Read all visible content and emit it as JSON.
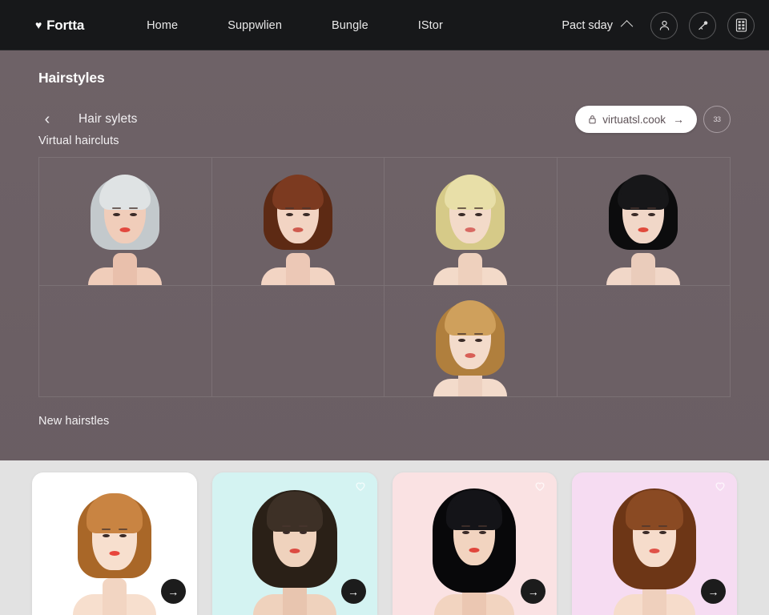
{
  "navbar": {
    "brand": "Fortta",
    "brand_icon": "heart-icon",
    "links": [
      {
        "label": "Home"
      },
      {
        "label": "Suppwlien"
      },
      {
        "label": "Bungle"
      },
      {
        "label": "IStor"
      }
    ],
    "selector": {
      "label": "Pact sday",
      "icon": "chevron-up-icon"
    },
    "icons": [
      {
        "name": "account-icon"
      },
      {
        "name": "key-icon"
      },
      {
        "name": "grid-panel-icon"
      }
    ]
  },
  "header": {
    "title": "Hairstyles",
    "back_icon": "chevron-left-icon",
    "breadcrumb": "Hair sylets",
    "url_pill": {
      "lock_icon": "lock-icon",
      "text": "virtuatsl.cook",
      "go_icon": "arrow-right-icon"
    },
    "ghost_button": "33"
  },
  "sections": {
    "virtual": {
      "label": "Virtual haircluts"
    },
    "new": {
      "label": "New hairstles"
    }
  },
  "grid_items": [
    {
      "name": "silver-bob",
      "hair": "#dfe3e4",
      "hair_dark": "#c3c9cc",
      "skin": "#f0cdba",
      "lip": "#e2483e",
      "row": 1
    },
    {
      "name": "auburn-bob",
      "hair": "#7c3a20",
      "hair_dark": "#5d2a14",
      "skin": "#f2d4c3",
      "lip": "#cf5a4e",
      "row": 1
    },
    {
      "name": "blonde-bangs",
      "hair": "#e8dfa8",
      "hair_dark": "#d6ca88",
      "skin": "#f3dac9",
      "lip": "#d86a63",
      "row": 1
    },
    {
      "name": "black-pixie",
      "hair": "#171719",
      "hair_dark": "#0c0c0d",
      "skin": "#f1d7c8",
      "lip": "#e04a3c",
      "row": 1
    },
    {
      "name": "empty-cell-1",
      "row": 2
    },
    {
      "name": "empty-cell-2",
      "row": 2
    },
    {
      "name": "honey-bob",
      "hair": "#cfa05c",
      "hair_dark": "#b07f3d",
      "skin": "#f3dbcb",
      "lip": "#d85f56",
      "row": 2
    },
    {
      "name": "empty-cell-3",
      "row": 2
    }
  ],
  "cards": [
    {
      "name": "ginger-bob-card",
      "bg": "#ffffff",
      "hair": "#c98442",
      "hair_dark": "#a96728",
      "skin": "#f7dfce",
      "lip": "#e8453c",
      "fav": false
    },
    {
      "name": "brunette-waves-card",
      "bg": "#d4f3f2",
      "hair": "#3d3026",
      "hair_dark": "#2a2017",
      "skin": "#efd2bd",
      "lip": "#dc4b42",
      "fav": true
    },
    {
      "name": "black-curls-card",
      "bg": "#fae2e3",
      "hair": "#141418",
      "hair_dark": "#08080a",
      "skin": "#f2d4c0",
      "lip": "#e0463c",
      "fav": true
    },
    {
      "name": "auburn-wavy-card",
      "bg": "#f6dcf2",
      "hair": "#8a4a23",
      "hair_dark": "#6d3616",
      "skin": "#f6dccb",
      "lip": "#e05248",
      "fav": true
    }
  ],
  "colors": {
    "nav_bg": "#17181a",
    "page_bg": "#6b5f64",
    "strip_bg": "#e2e2e2",
    "accent_dark": "#1c1c1c"
  }
}
